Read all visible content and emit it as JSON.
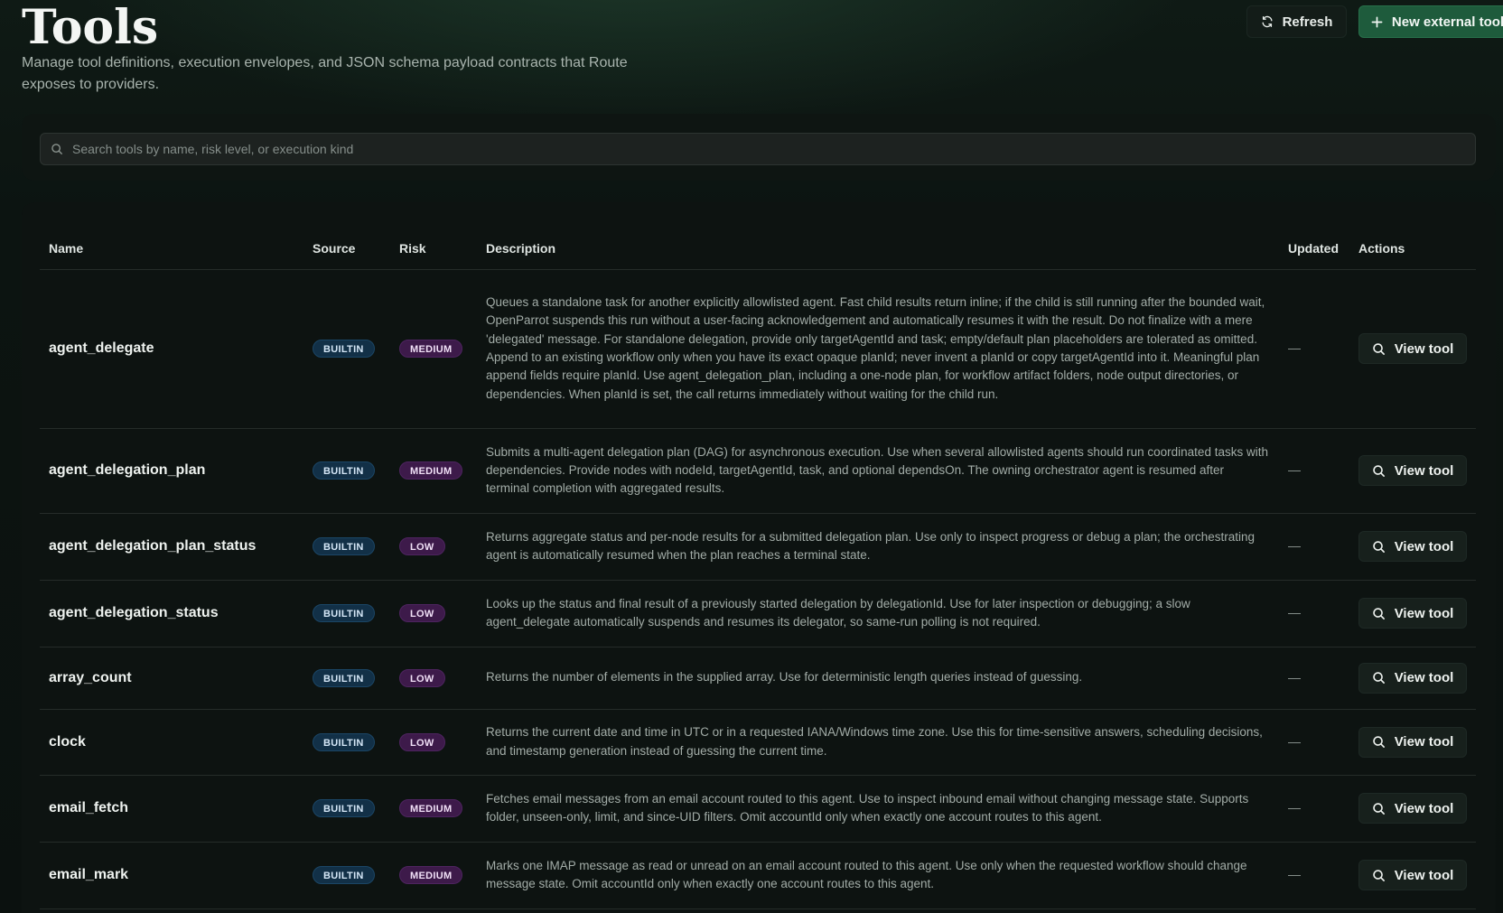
{
  "header": {
    "title": "Tools",
    "subtitle": "Manage tool definitions, execution envelopes, and JSON schema payload contracts that Route exposes to providers.",
    "refresh_label": "Refresh",
    "new_tool_label": "New external tool"
  },
  "search": {
    "placeholder": "Search tools by name, risk level, or execution kind",
    "value": ""
  },
  "table": {
    "columns": [
      "Name",
      "Source",
      "Risk",
      "Description",
      "Updated",
      "Actions"
    ],
    "rows": [
      {
        "name": "agent_delegate",
        "source": "BUILTIN",
        "risk": "MEDIUM",
        "description": "Queues a standalone task for another explicitly allowlisted agent. Fast child results return inline; if the child is still running after the bounded wait, OpenParrot suspends this run without a user-facing acknowledgement and automatically resumes it with the result. Do not finalize with a mere 'delegated' message. For standalone delegation, provide only targetAgentId and task; empty/default plan placeholders are tolerated as omitted. Append to an existing workflow only when you have its exact opaque planId; never invent a planId or copy targetAgentId into it. Meaningful plan append fields require planId. Use agent_delegation_plan, including a one-node plan, for workflow artifact folders, node output directories, or dependencies. When planId is set, the call returns immediately without waiting for the child run.",
        "updated": "—",
        "action": "View tool"
      },
      {
        "name": "agent_delegation_plan",
        "source": "BUILTIN",
        "risk": "MEDIUM",
        "description": "Submits a multi-agent delegation plan (DAG) for asynchronous execution. Use when several allowlisted agents should run coordinated tasks with dependencies. Provide nodes with nodeId, targetAgentId, task, and optional dependsOn. The owning orchestrator agent is resumed after terminal completion with aggregated results.",
        "updated": "—",
        "action": "View tool"
      },
      {
        "name": "agent_delegation_plan_status",
        "source": "BUILTIN",
        "risk": "LOW",
        "description": "Returns aggregate status and per-node results for a submitted delegation plan. Use only to inspect progress or debug a plan; the orchestrating agent is automatically resumed when the plan reaches a terminal state.",
        "updated": "—",
        "action": "View tool"
      },
      {
        "name": "agent_delegation_status",
        "source": "BUILTIN",
        "risk": "LOW",
        "description": "Looks up the status and final result of a previously started delegation by delegationId. Use for later inspection or debugging; a slow agent_delegate automatically suspends and resumes its delegator, so same-run polling is not required.",
        "updated": "—",
        "action": "View tool"
      },
      {
        "name": "array_count",
        "source": "BUILTIN",
        "risk": "LOW",
        "description": "Returns the number of elements in the supplied array. Use for deterministic length queries instead of guessing.",
        "updated": "—",
        "action": "View tool"
      },
      {
        "name": "clock",
        "source": "BUILTIN",
        "risk": "LOW",
        "description": "Returns the current date and time in UTC or in a requested IANA/Windows time zone. Use this for time-sensitive answers, scheduling decisions, and timestamp generation instead of guessing the current time.",
        "updated": "—",
        "action": "View tool"
      },
      {
        "name": "email_fetch",
        "source": "BUILTIN",
        "risk": "MEDIUM",
        "description": "Fetches email messages from an email account routed to this agent. Use to inspect inbound email without changing message state. Supports folder, unseen-only, limit, and since-UID filters. Omit accountId only when exactly one account routes to this agent.",
        "updated": "—",
        "action": "View tool"
      },
      {
        "name": "email_mark",
        "source": "BUILTIN",
        "risk": "MEDIUM",
        "description": "Marks one IMAP message as read or unread on an email account routed to this agent. Use only when the requested workflow should change message state. Omit accountId only when exactly one account routes to this agent.",
        "updated": "—",
        "action": "View tool"
      }
    ]
  },
  "icons": {
    "refresh": "refresh-icon",
    "add": "plus-icon",
    "search": "search-icon",
    "view": "magnifier-icon"
  },
  "colors": {
    "accent": "#1e5b3c",
    "badge_builtin": "#123047",
    "badge_risk": "#3d1a4a"
  }
}
